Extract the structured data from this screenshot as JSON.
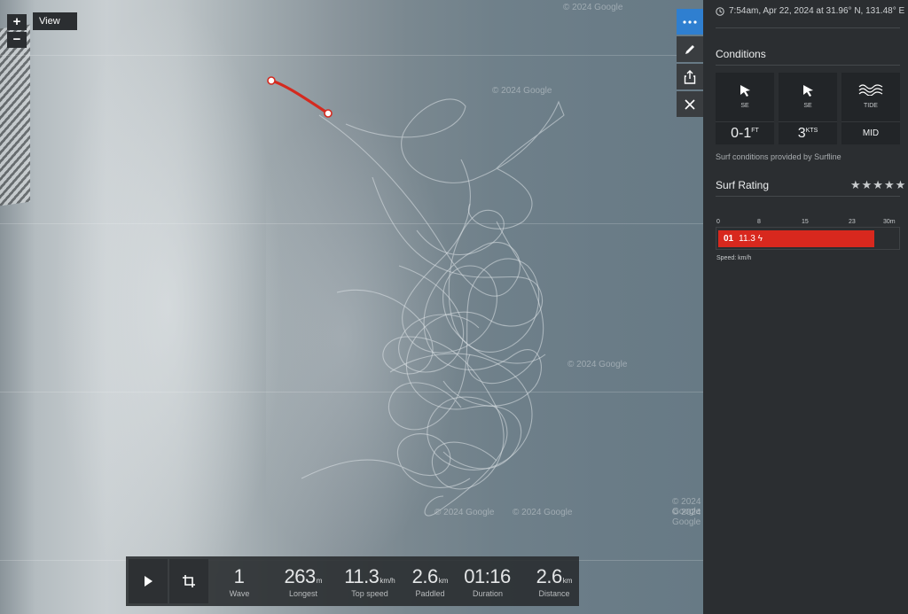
{
  "map": {
    "view_label": "View",
    "zoom_in": "+",
    "zoom_out": "−",
    "watermarks": [
      "© 2024 Google",
      "© 2024 Google",
      "© 2024 Google",
      "© 2024 Google",
      "© 2024 Google",
      "© 2024 Google",
      "© 2024 Google"
    ]
  },
  "toolbar": {
    "icons": [
      "more-icon",
      "pencil-icon",
      "share-icon",
      "close-icon"
    ]
  },
  "player": {
    "stats": [
      {
        "value": "1",
        "unit": "",
        "label": "Wave"
      },
      {
        "value": "263",
        "unit": "m",
        "label": "Longest"
      },
      {
        "value": "11.3",
        "unit": "km/h",
        "label": "Top speed"
      },
      {
        "value": "2.6",
        "unit": "km",
        "label": "Paddled"
      },
      {
        "value": "01:16",
        "unit": "",
        "label": "Duration"
      },
      {
        "value": "2.6",
        "unit": "km",
        "label": "Distance"
      }
    ]
  },
  "panel": {
    "timestamp": "7:54am, Apr 22, 2024 at 31.96° N, 131.48° E",
    "conditions_title": "Conditions",
    "cards": [
      {
        "icon": "wave-direction-icon",
        "label": "SE",
        "value": "0-1",
        "unit": "FT"
      },
      {
        "icon": "wind-direction-icon",
        "label": "SE",
        "value": "3",
        "unit": "KTS"
      },
      {
        "icon": "tide-icon",
        "label": "TIDE",
        "value": "MID",
        "unit": ""
      }
    ],
    "credit": "Surf conditions provided by Surfline",
    "rating_title": "Surf Rating",
    "stars": "★★★★★",
    "scale_ticks": [
      "0",
      "8",
      "15",
      "23",
      "30m"
    ],
    "wave_number": "01",
    "wave_speed": "11.3",
    "speed_label": "Speed: km/h",
    "accent_color": "#d8281e"
  }
}
